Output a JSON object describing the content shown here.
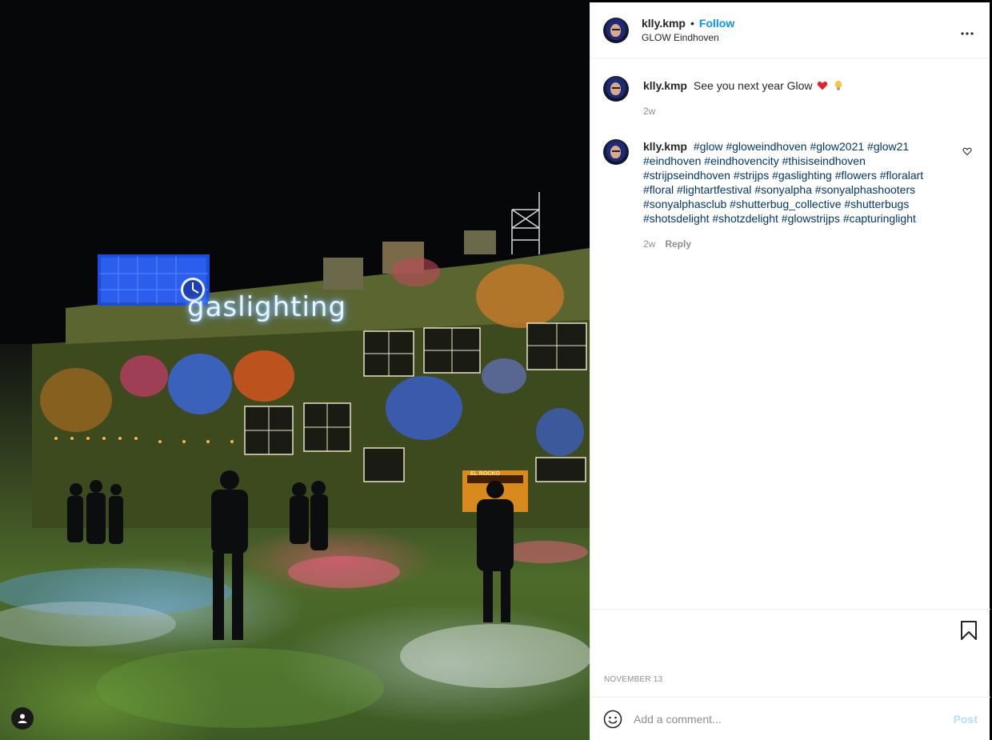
{
  "post": {
    "author": "klly.kmp",
    "separator": "•",
    "follow_label": "Follow",
    "location": "GLOW Eindhoven",
    "more_icon": "ellipsis-icon",
    "photo": {
      "sign_text": "gaslighting",
      "food_truck_text": "EL ROCKO"
    }
  },
  "caption": {
    "username": "klly.kmp",
    "text": "See you next year Glow",
    "emojis": [
      "red-heart",
      "light-bulb"
    ],
    "time": "2w"
  },
  "comment": {
    "username": "klly.kmp",
    "hashtags": "#glow #gloweindhoven #glow2021 #glow21 #eindhoven #eindhovencity #thisiseindhoven #strijpseindhoven #strijps #gaslighting #flowers #floralart #floral #lightartfestival #sonyalpha #sonyalphashooters #sonyalphasclub #shutterbug_collective #shutterbugs #shotsdelight #shotzdelight #glowstrijps #capturinglight",
    "time": "2w",
    "reply_label": "Reply"
  },
  "actions": {
    "date": "NOVEMBER 13"
  },
  "add_comment": {
    "placeholder": "Add a comment...",
    "post_label": "Post"
  },
  "colors": {
    "accent": "#0095f6",
    "hashtag": "#00376b",
    "muted": "#8e8e8e",
    "post_disabled": "#b2dffc"
  }
}
